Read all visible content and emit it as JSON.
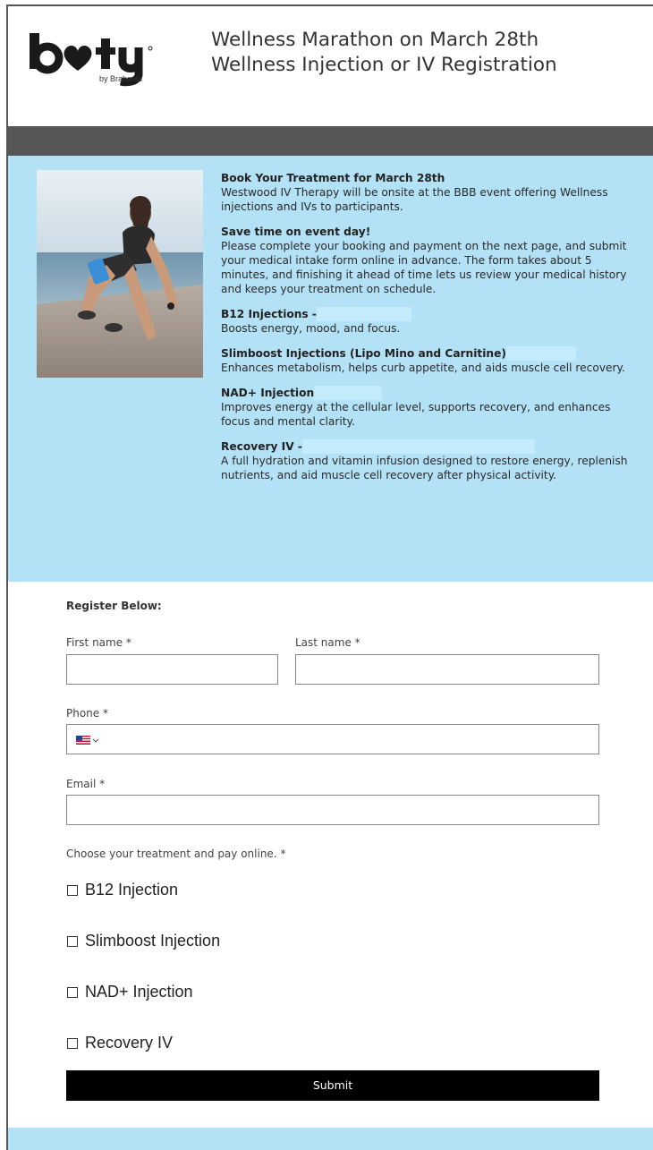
{
  "header": {
    "logo_text": "booty",
    "logo_sub": "by Brabants",
    "title_line1": "Wellness Marathon on March 28th",
    "title_line2": "Wellness Injection or IV Registration"
  },
  "info": {
    "book": {
      "heading": "Book Your Treatment for March 28th",
      "text": "Westwood IV Therapy will be onsite at the BBB event offering Wellness injections and IVs to participants."
    },
    "save": {
      "heading": "Save time on event day!",
      "text": "Please complete your booking and payment on the next page, and submit your medical intake form online in advance. The form takes about 5 minutes, and finishing it ahead of time lets us review your medical history and keeps your treatment on schedule."
    },
    "treatments": [
      {
        "heading": "B12 Injections -",
        "text": "Boosts energy, mood, and focus."
      },
      {
        "heading": "Slimboost Injections (Lipo Mino and Carnitine)",
        "text": "Enhances metabolism, helps curb appetite, and aids muscle cell recovery."
      },
      {
        "heading": "NAD+ Injection",
        "text": "Improves energy at the cellular level, supports recovery, and enhances focus and mental clarity."
      },
      {
        "heading": "Recovery IV -",
        "text": "A full hydration and vitamin infusion designed to restore energy, replenish nutrients, and aid muscle cell recovery after physical activity."
      }
    ]
  },
  "form": {
    "title": "Register Below:",
    "first_name_label": "First name *",
    "first_name_value": "",
    "last_name_label": "Last name *",
    "last_name_value": "",
    "phone_label": "Phone *",
    "phone_value": "",
    "phone_country_icon": "us-flag-icon",
    "email_label": "Email *",
    "email_value": "",
    "treatment_label": "Choose your treatment and pay online. *",
    "options": [
      "B12 Injection",
      "Slimboost Injection",
      "NAD+ Injection",
      "Recovery IV"
    ],
    "submit_label": "Submit"
  },
  "colors": {
    "info_bg": "#b3e1f5",
    "dark_bar": "#575757",
    "submit_bg": "#000000"
  }
}
